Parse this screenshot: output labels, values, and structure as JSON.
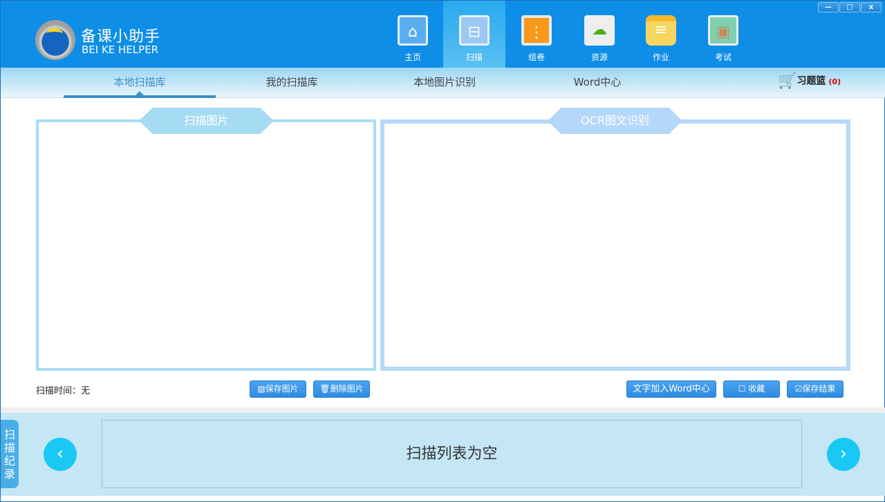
{
  "brand": {
    "name_cn": "备课小助手",
    "name_en": "BEI KE HELPER"
  },
  "window_controls": {
    "minimize": "—",
    "maximize": "□",
    "close": "x"
  },
  "nav": [
    {
      "label": "主页",
      "icon": "home-icon"
    },
    {
      "label": "扫描",
      "icon": "scan-icon"
    },
    {
      "label": "组卷",
      "icon": "folder-icon"
    },
    {
      "label": "资源",
      "icon": "share-cloud-icon"
    },
    {
      "label": "作业",
      "icon": "notes-icon"
    },
    {
      "label": "考试",
      "icon": "exam-envelope-icon"
    }
  ],
  "tabs": [
    "本地扫描库",
    "我的扫描库",
    "本地图片识别",
    "Word中心"
  ],
  "basket": {
    "label": "习题篮",
    "count": "(0)"
  },
  "panels": {
    "left_title": "扫描图片",
    "right_title": "OCR图文识别"
  },
  "scan_time": "扫描时间：无",
  "buttons": {
    "save_image": "保存图片",
    "delete_image": "删除图片",
    "add_word": "文字加入Word中心",
    "favorite": "收藏",
    "save_result": "保存结果"
  },
  "bottom": {
    "empty_text": "扫描列表为空",
    "side_tab": "扫描纪录"
  },
  "colors": {
    "header": "#0e8ee6",
    "accent": "#1ac8f5"
  }
}
